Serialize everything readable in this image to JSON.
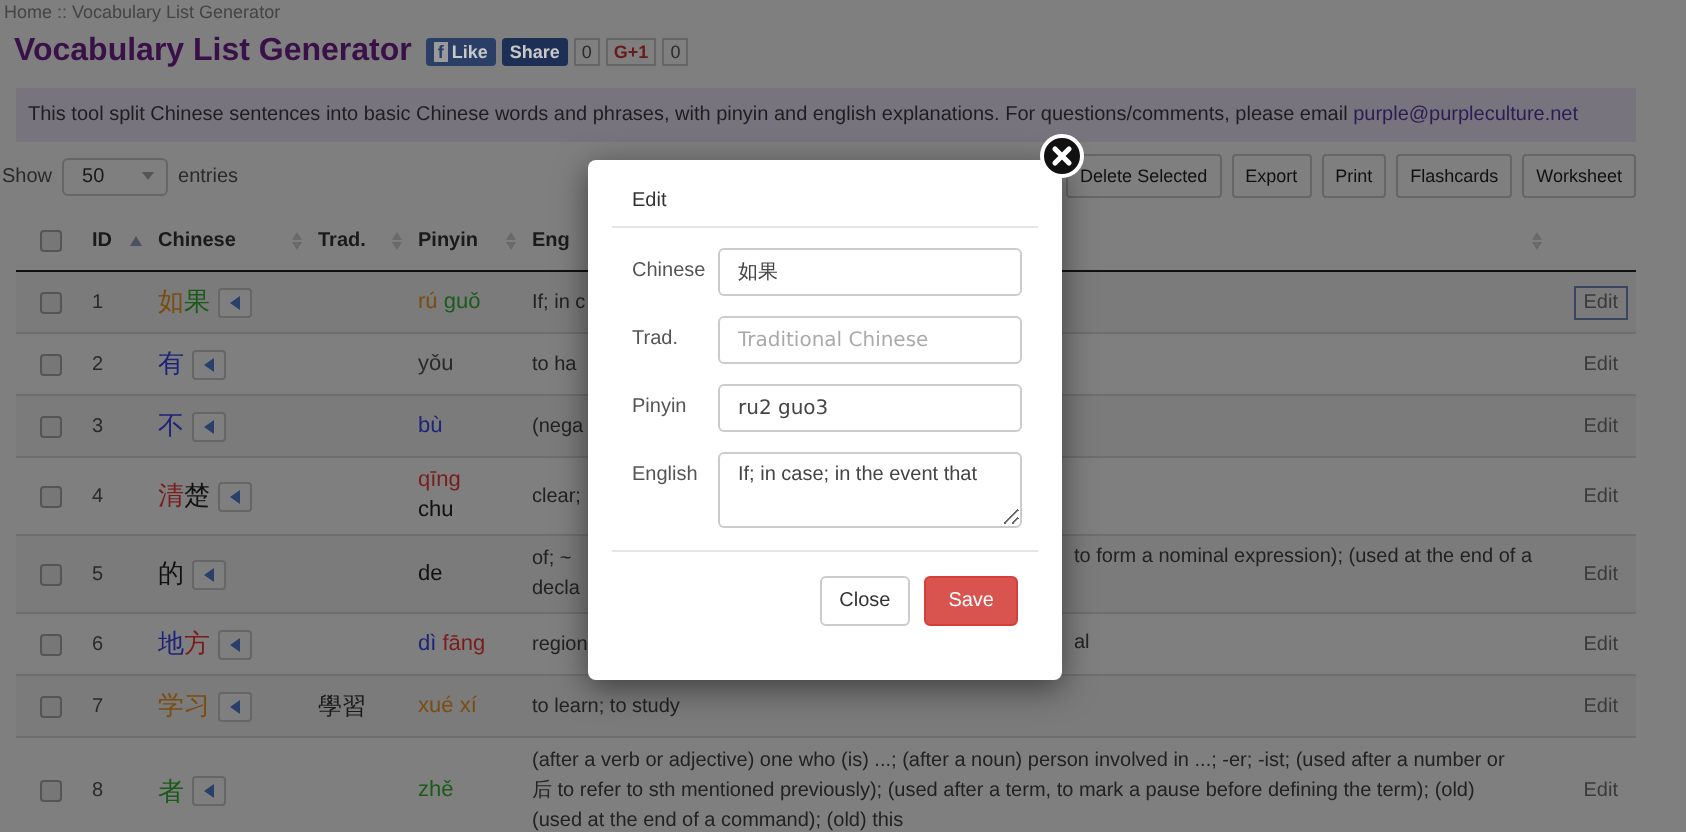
{
  "breadcrumb": "Home :: Vocabulary List Generator",
  "title": "Vocabulary List Generator",
  "social": {
    "like_icon": "f",
    "like": "Like",
    "share": "Share",
    "share_count": "0",
    "gplus": "G+1",
    "gplus_count": "0"
  },
  "intro": {
    "text": "This tool split Chinese sentences into basic Chinese words and phrases, with pinyin and english explanations. For questions/comments, please email ",
    "email": "purple@purpleculture.net"
  },
  "show": {
    "label": "Show",
    "value": "50",
    "suffix": "entries"
  },
  "toolbar": [
    "Delete Selected",
    "Export",
    "Print",
    "Flashcards",
    "Worksheet"
  ],
  "table": {
    "select_all_checked": false,
    "columns": [
      {
        "label": "ID",
        "sorted": true
      },
      {
        "label": "Chinese",
        "sorted": false
      },
      {
        "label": "Trad.",
        "sorted": false
      },
      {
        "label": "Pinyin",
        "sorted": false
      },
      {
        "label": "Eng",
        "sorted": false
      }
    ],
    "rows": [
      {
        "checked": false,
        "id": "1",
        "chinese": [
          {
            "text": "如",
            "color": "#7a4d10"
          },
          {
            "text": "果",
            "color": "#1a5a1a"
          }
        ],
        "trad": "",
        "pinyin": [
          {
            "text": "rú",
            "color": "#7a4d10"
          },
          {
            "text": "guǒ",
            "color": "#1a5a1a"
          }
        ],
        "english_left": [
          "If; in c"
        ],
        "english_right": [],
        "edit": "Edit",
        "focused": true
      },
      {
        "checked": false,
        "id": "2",
        "chinese": [
          {
            "text": "有",
            "color": "#1e237a"
          }
        ],
        "trad": "",
        "pinyin": [
          {
            "text": "yǒu",
            "color": "#2a2a2a"
          }
        ],
        "english_left": [
          "to ha"
        ],
        "english_right": [],
        "edit": "Edit",
        "focused": false
      },
      {
        "checked": false,
        "id": "3",
        "chinese": [
          {
            "text": "不",
            "color": "#1e237a"
          }
        ],
        "trad": "",
        "pinyin": [
          {
            "text": "bù",
            "color": "#1e237a"
          }
        ],
        "english_left": [
          "(nega"
        ],
        "english_right": [],
        "edit": "Edit",
        "focused": false
      },
      {
        "checked": false,
        "id": "4",
        "chinese": [
          {
            "text": "清",
            "color": "#7a1c1c"
          },
          {
            "text": "楚",
            "color": "#111111"
          }
        ],
        "trad": "",
        "pinyin": [
          {
            "text": "qīng",
            "color": "#7a1c1c"
          },
          {
            "text": "chu",
            "color": "#111111"
          }
        ],
        "english_left": [
          "clear;"
        ],
        "english_right": [],
        "edit": "Edit",
        "focused": false
      },
      {
        "checked": false,
        "id": "5",
        "chinese": [
          {
            "text": "的",
            "color": "#111111"
          }
        ],
        "trad": "",
        "pinyin": [
          {
            "text": "de",
            "color": "#111111"
          }
        ],
        "english_left": [
          "of; ~",
          "decla"
        ],
        "english_right": [
          "to form a nominal expression); (used at the end of a"
        ],
        "edit": "Edit",
        "focused": false
      },
      {
        "checked": false,
        "id": "6",
        "chinese": [
          {
            "text": "地",
            "color": "#1e237a"
          },
          {
            "text": "方",
            "color": "#7a1c1c"
          }
        ],
        "trad": "",
        "pinyin": [
          {
            "text": "dì",
            "color": "#1e237a"
          },
          {
            "text": "fāng",
            "color": "#7a1c1c"
          }
        ],
        "english_left": [
          "region"
        ],
        "english_right": [
          "al"
        ],
        "edit": "Edit",
        "focused": false
      },
      {
        "checked": false,
        "id": "7",
        "chinese": [
          {
            "text": "学",
            "color": "#7a4d10"
          },
          {
            "text": "习",
            "color": "#7a4d10"
          }
        ],
        "trad": "學習",
        "pinyin": [
          {
            "text": "xué",
            "color": "#7a4d10"
          },
          {
            "text": "xí",
            "color": "#7a4d10"
          }
        ],
        "english_left": [
          "to learn; to study"
        ],
        "english_right": [],
        "edit": "Edit",
        "focused": false
      },
      {
        "checked": false,
        "id": "8",
        "chinese": [
          {
            "text": "者",
            "color": "#1a5a1a"
          }
        ],
        "trad": "",
        "pinyin": [
          {
            "text": "zhě",
            "color": "#1a5a1a"
          }
        ],
        "english_left": [
          "(after a verb or adjective) one who (is) ...; (after a noun) person involved in ...; -er; -ist; (used after a number or",
          "后 to refer to sth mentioned previously); (used after a term, to mark a pause before defining the term); (old)",
          "(used at the end of a command); (old) this"
        ],
        "english_right": [],
        "edit": "Edit",
        "focused": false
      }
    ]
  },
  "modal": {
    "title": "Edit",
    "fields": [
      {
        "kind": "input",
        "label": "Chinese",
        "value": "如果"
      },
      {
        "kind": "input",
        "label": "Trad.",
        "placeholder": "Traditional Chinese"
      },
      {
        "kind": "input",
        "label": "Pinyin",
        "value": "ru2 guo3"
      },
      {
        "kind": "textarea",
        "label": "English",
        "value": "If; in case; in the event that"
      }
    ],
    "close": "Close",
    "save": "Save"
  }
}
